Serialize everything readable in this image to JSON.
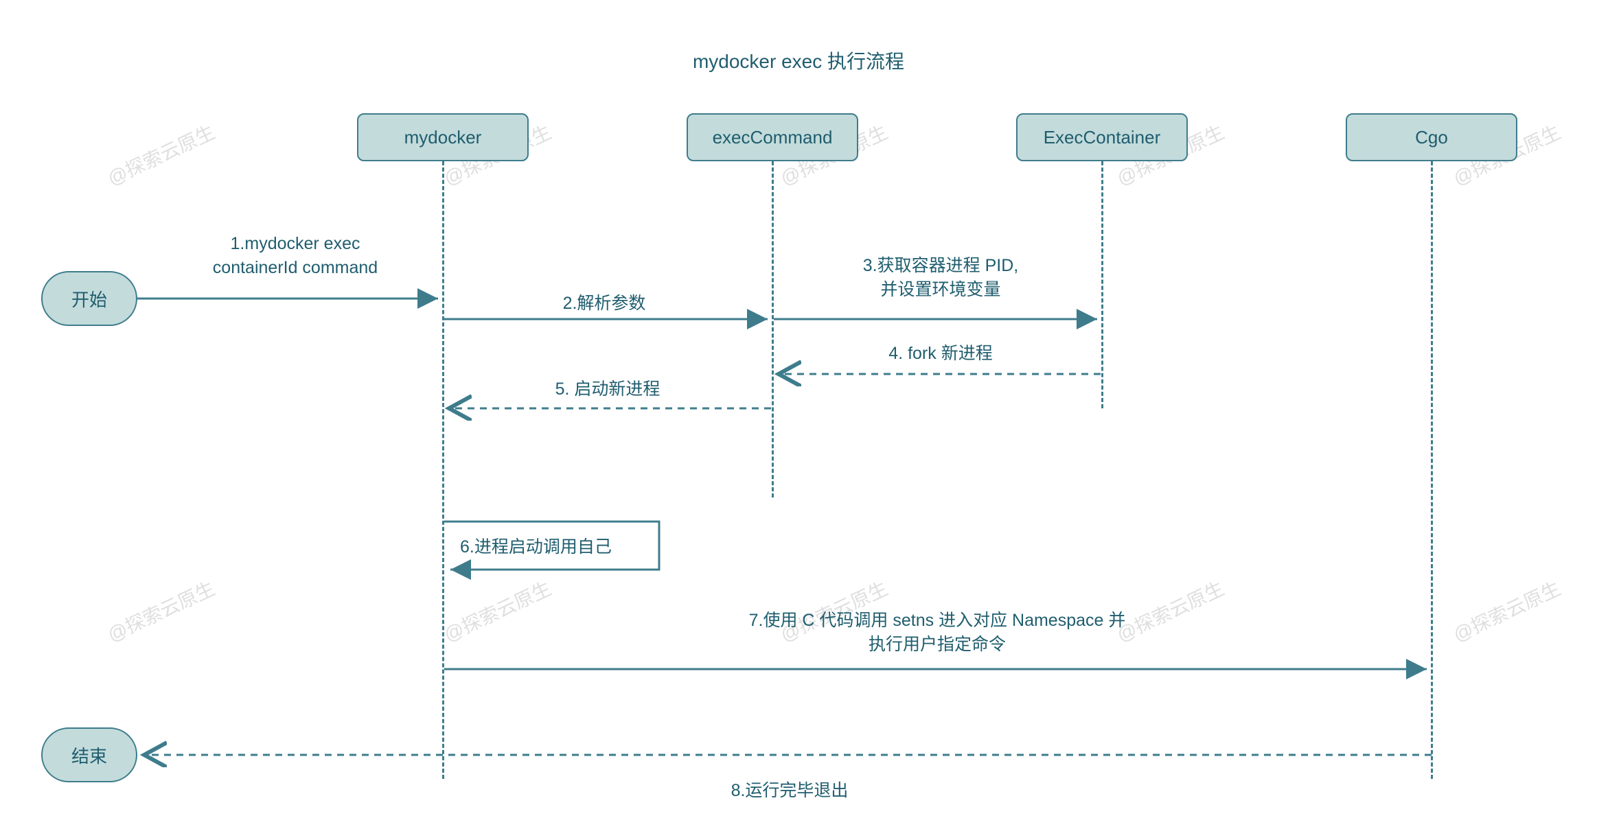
{
  "title": "mydocker exec 执行流程",
  "participants": {
    "mydocker": "mydocker",
    "execCommand": "execCommand",
    "execContainer": "ExecContainer",
    "cgo": "Cgo"
  },
  "terminals": {
    "start": "开始",
    "end": "结束"
  },
  "messages": {
    "m1_line1": "1.mydocker exec",
    "m1_line2": "containerId command",
    "m2": "2.解析参数",
    "m3_line1": "3.获取容器进程 PID,",
    "m3_line2": "并设置环境变量",
    "m4": "4. fork 新进程",
    "m5": "5. 启动新进程",
    "m6": "6.进程启动调用自己",
    "m7_line1": "7.使用 C 代码调用 setns 进入对应 Namespace 并",
    "m7_line2": "执行用户指定命令",
    "m8": "8.运行完毕退出"
  },
  "watermark": "@探索云原生",
  "colors": {
    "stroke": "#3e7c8c",
    "fill": "#c3dbdb",
    "text": "#1f5d6e"
  }
}
